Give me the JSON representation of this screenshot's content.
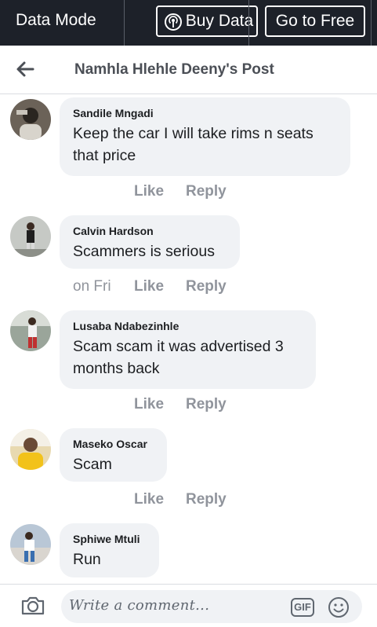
{
  "top_bar": {
    "mode_label": "Data Mode",
    "buy_label": "Buy Data",
    "free_label": "Go to Free"
  },
  "header": {
    "title": "Namhla Hlehle Deeny's Post"
  },
  "comments": [
    {
      "author": "Sandile Mngadi",
      "text": "Keep  the car I will take rims n seats that price",
      "time": "",
      "like": "Like",
      "reply": "Reply"
    },
    {
      "author": "Calvin Hardson",
      "text": "Scammers is serious",
      "time": "on Fri",
      "like": "Like",
      "reply": "Reply"
    },
    {
      "author": "Lusaba Ndabezinhle",
      "text": "Scam scam it was advertised 3 months back",
      "time": "",
      "like": "Like",
      "reply": "Reply"
    },
    {
      "author": "Maseko Oscar",
      "text": "Scam",
      "time": "",
      "like": "Like",
      "reply": "Reply"
    },
    {
      "author": "Sphiwe Mtuli",
      "text": "Run",
      "time": "",
      "like": "",
      "reply": ""
    }
  ],
  "composer": {
    "placeholder": "Write a comment...",
    "gif_label": "GIF"
  },
  "colors": {
    "top_bar_bg": "#1d2129",
    "bubble_bg": "#f0f2f5",
    "action_text": "#90949c"
  }
}
